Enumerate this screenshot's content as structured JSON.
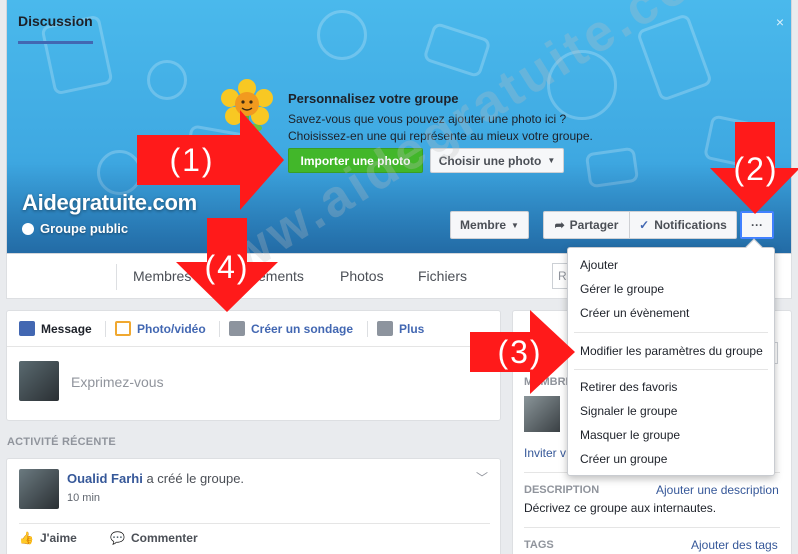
{
  "cover": {
    "personalize_title": "Personnalisez votre groupe",
    "personalize_line1": "Savez-vous que vous pouvez ajouter une photo ici ?",
    "personalize_line2": "Choisissez-en une qui représente au mieux votre groupe.",
    "import_button": "Importer une photo",
    "choose_button": "Choisir une photo",
    "close": "×",
    "group_name": "Aidegratuite.com",
    "group_type": "Groupe public",
    "member_button": "Membre",
    "share_button": "Partager",
    "notifications_button": "Notifications",
    "more_button": "···"
  },
  "nav": {
    "tabs": [
      "Discussion",
      "Membres",
      "Évènements",
      "Photos",
      "Fichiers"
    ],
    "membres_visible": "Membres",
    "evenements_visible": "ements",
    "search_fragment": "R"
  },
  "composer": {
    "tabs": [
      "Message",
      "Photo/vidéo",
      "Créer un sondage",
      "Plus"
    ],
    "placeholder": "Exprimez-vous"
  },
  "recent_activity_label": "ACTIVITÉ RÉCENTE",
  "post": {
    "author": "Oualid Farhi",
    "action": "a créé le groupe.",
    "time": "10 min",
    "like": "J'aime",
    "comment": "Commenter"
  },
  "right_column": {
    "members_fragment": "MEMBRE",
    "ajouter_fragment": "AJOUTE",
    "s_fragment": "s",
    "invite": "Inviter v",
    "description_label": "DESCRIPTION",
    "description_link": "Ajouter une description",
    "description_text": "Décrivez ce groupe aux internautes.",
    "tags_label": "TAGS",
    "tags_link": "Ajouter des tags"
  },
  "menu": {
    "items": [
      "Ajouter",
      "Gérer le groupe",
      "Créer un évènement",
      "Modifier les paramètres du groupe",
      "Retirer des favoris",
      "Signaler le groupe",
      "Masquer le groupe",
      "Créer un groupe"
    ]
  },
  "annotations": {
    "arrow1": "(1)",
    "arrow2": "(2)",
    "arrow3": "(3)",
    "arrow4": "(4)",
    "arrow_color": "#ff1a1a"
  },
  "watermark": "www.aidegratuite.com"
}
